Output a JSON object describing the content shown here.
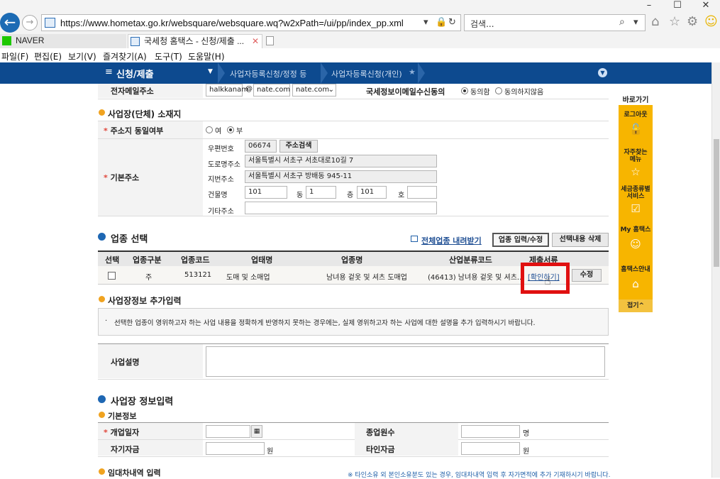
{
  "browser": {
    "url": "https://www.hometax.go.kr/websquare/websquare.wq?w2xPath=/ui/pp/index_pp.xml",
    "search_placeholder": "검색...",
    "tabs": [
      {
        "label": "NAVER",
        "active": false
      },
      {
        "label": "국세청 홈택스 - 신청/제출 ...",
        "active": true
      }
    ],
    "menu": [
      "파일(F)",
      "편집(E)",
      "보기(V)",
      "즐겨찾기(A)",
      "도구(T)",
      "도움말(H)"
    ]
  },
  "nav": {
    "title": "신청/제출",
    "crumbs": [
      "사업자등록신청/정정 등",
      "사업자등록신청(개인)"
    ]
  },
  "email": {
    "label": "전자메일주소",
    "id": "halkkanam",
    "at": "@",
    "domain": "nate.com",
    "domain_select": "nate.com",
    "consent_label": "국세정보이메일수신동의",
    "agree": "동의함",
    "disagree": "동의하지않음"
  },
  "location": {
    "section_title": "사업장(단체) 소재지",
    "same_label": "주소지 동일여부",
    "yes": "여",
    "no": "부",
    "base_label": "기본주소",
    "zip_label": "우편번호",
    "zip": "06674",
    "zip_search": "주소검색",
    "road_label": "도로명주소",
    "road": "서울특별시 서초구 서초대로10길 7",
    "jibun_label": "지번주소",
    "jibun": "서울특별시 서초구 방배동 945-11",
    "bldg_label": "건물명",
    "bldg": "101",
    "dong_label": "동",
    "dong": "1",
    "floor_label": "층",
    "floor": "101",
    "ho_label": "호",
    "ho": "",
    "etc_label": "기타주소",
    "etc": ""
  },
  "industry": {
    "section_title": "업종 선택",
    "download_link": "전체업종 내려받기",
    "input_button": "업종 입력/수정",
    "delete_button": "선택내용 삭제",
    "headers": [
      "선택",
      "업종구분",
      "업종코드",
      "업태명",
      "업종명",
      "산업분류코드",
      "제출서류"
    ],
    "row": {
      "type": "주",
      "code": "513121",
      "biz": "도매 및 소매업",
      "name": "남녀용 겉옷 및 셔츠 도매업",
      "ksic": "(46413) 남녀용 겉옷 및 셔츠...",
      "confirm": "[확인하기]",
      "edit": "수정"
    }
  },
  "extra": {
    "section_title": "사업장정보 추가입력",
    "notice": "선택한 업종이 영위하고자 하는 사업 내용을 정확하게 반영하지 못하는 경우에는, 실제 영위하고자 하는 사업에 대한 설명을 추가 입력하시기 바랍니다.",
    "desc_label": "사업설명"
  },
  "bizinfo": {
    "section_title": "사업장 정보입력",
    "sub_title": "기본정보",
    "open_date_label": "개업일자",
    "employees_label": "종업원수",
    "employees_unit": "명",
    "own_capital_label": "자기자금",
    "own_unit": "원",
    "other_capital_label": "타인자금",
    "other_unit": "원",
    "lease_title": "임대차내역 입력",
    "lease_note": "※ 타인소유 외 본인소유분도 있는 경우, 임대차내역 입력 후 자가면적에 추가 기재하시기 바랍니다."
  },
  "quick": {
    "title": "바로가기",
    "items": [
      "로그아웃",
      "자주찾는\n메뉴",
      "세금종류별\n서비스",
      "My 홈택스",
      "홈택스안내",
      "접기^"
    ]
  },
  "colors": {
    "nav_bg": "#0d4a8f",
    "quick_bg": "#f7b500",
    "highlight": "#e01010"
  }
}
